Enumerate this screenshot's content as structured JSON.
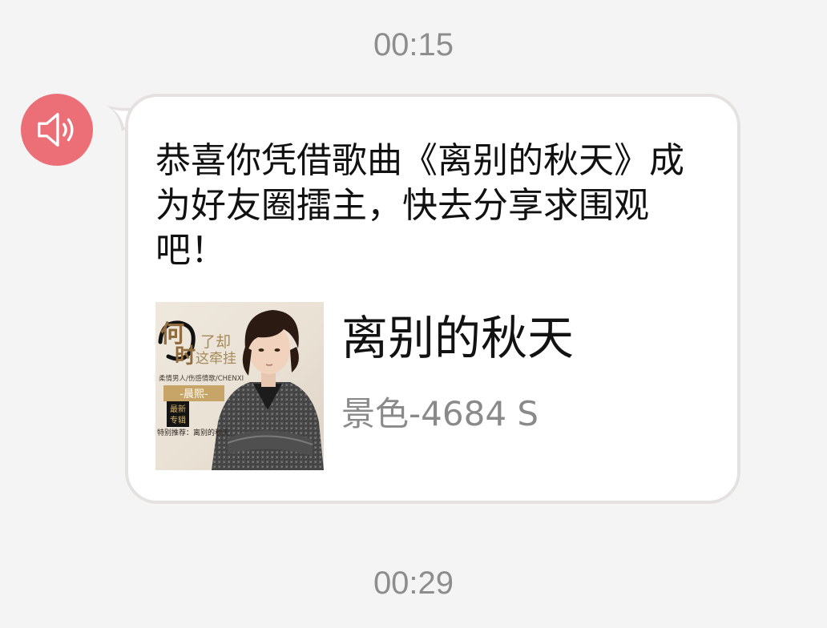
{
  "timestamps": {
    "top": "00:15",
    "bottom": "00:29"
  },
  "sender": {
    "avatar_icon": "speaker-icon",
    "avatar_color": "#ec6f78"
  },
  "message": {
    "text": "恭喜你凭借歌曲《离别的秋天》成为好友圈擂主，快去分享求围观吧！",
    "song_card": {
      "title": "离别的秋天",
      "artist": "景色-4684 S",
      "cover": {
        "title_char_1": "何",
        "title_char_2": "时",
        "title_rest": "了却",
        "title_rest_2": "这牵挂",
        "subtitle": "柔情男人/伤感情歌/CHENXI",
        "artist_banner": "-晨熙-",
        "badge_line_1": "最新",
        "badge_line_2": "专辑",
        "recommend": "特别推荐：离别的秋天"
      }
    }
  },
  "colors": {
    "background": "#f4f4f4",
    "bubble": "#ffffff",
    "bubble_border": "#e6e1e1",
    "timestamp": "#8d8d8d",
    "artist_text": "#8a8a8a"
  }
}
